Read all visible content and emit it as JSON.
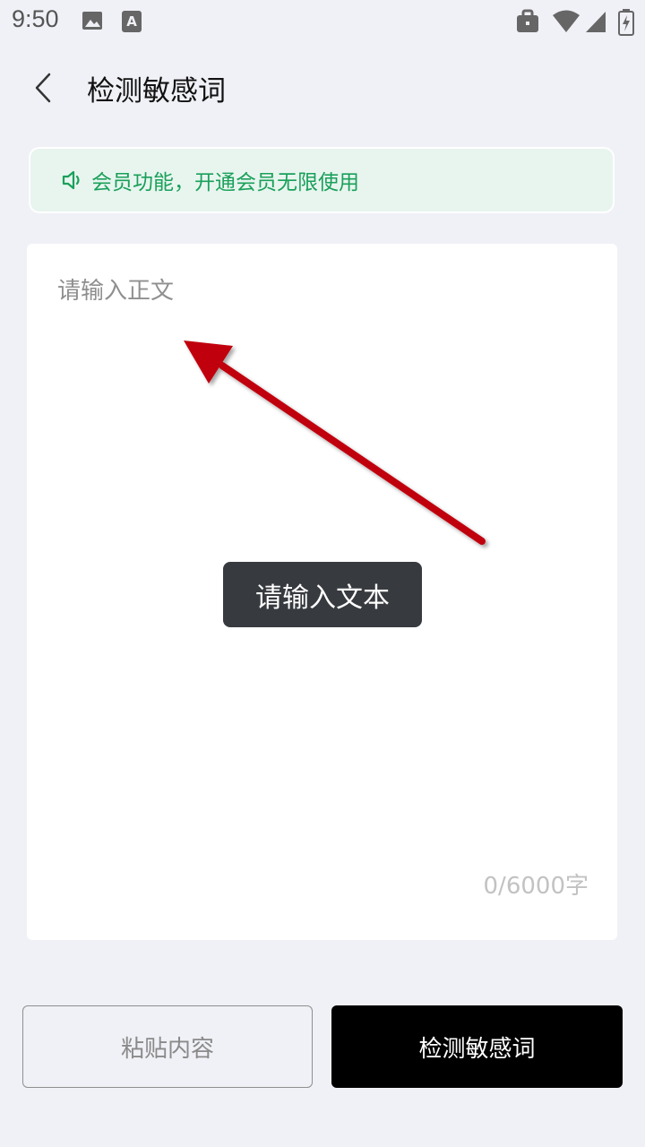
{
  "status_bar": {
    "time": "9:50",
    "icons": [
      "image-icon",
      "text-icon",
      "briefcase-icon",
      "wifi-icon",
      "signal-icon",
      "battery-charging-icon"
    ]
  },
  "header": {
    "back_icon": "chevron-left-icon",
    "title": "检测敏感词"
  },
  "banner": {
    "icon": "speaker-icon",
    "text": "会员功能，开通会员无限使用",
    "color": "#1aa05a",
    "background": "#e8f5ef"
  },
  "editor": {
    "placeholder": "请输入正文",
    "value": "",
    "char_count": "0/6000字"
  },
  "toast": {
    "text": "请输入文本"
  },
  "actions": {
    "paste_label": "粘贴内容",
    "detect_label": "检测敏感词"
  },
  "colors": {
    "page_background": "#f0f1f6",
    "primary_button": "#000000",
    "annotation_arrow": "#c0000c"
  }
}
